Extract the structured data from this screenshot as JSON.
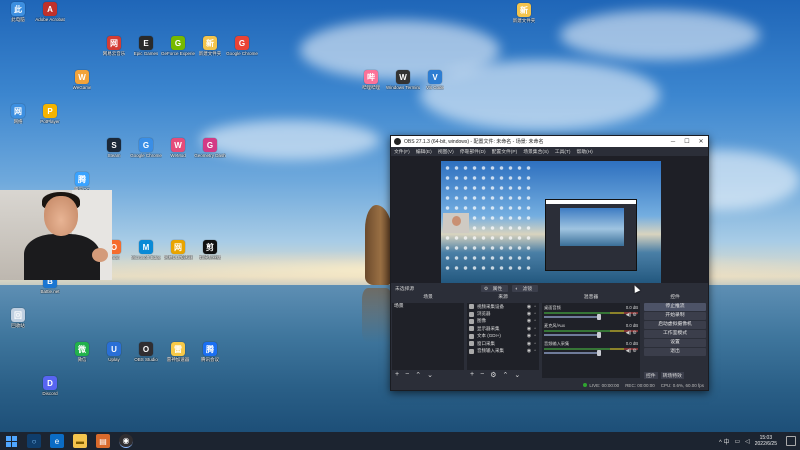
{
  "desktop": {
    "icons": [
      {
        "label": "此电脑",
        "icon": "computer-icon",
        "color": "#3d8fe0"
      },
      {
        "label": "网络",
        "icon": "network-icon",
        "color": "#3d8fe0"
      },
      {
        "label": "回收站",
        "icon": "recycle-bin-icon",
        "color": "#bfcfe0"
      },
      {
        "label": "Adobe Acrobat",
        "icon": "adobe-icon",
        "color": "#c0312b"
      },
      {
        "label": "PotPlayer",
        "icon": "potplayer-icon",
        "color": "#f5b400"
      },
      {
        "label": "Battle.net",
        "icon": "battlenet-icon",
        "color": "#1a76d2"
      },
      {
        "label": "Discord",
        "icon": "discord-icon",
        "color": "#5865f2"
      },
      {
        "label": "WeGame",
        "icon": "wegame-icon",
        "color": "#f2a33a"
      },
      {
        "label": "腾讯QQ",
        "icon": "qq-icon",
        "color": "#3aa3ff"
      },
      {
        "label": "微信",
        "icon": "wechat-icon",
        "color": "#22b14c"
      },
      {
        "label": "网易云音乐",
        "icon": "netease-music-icon",
        "color": "#d43c33"
      },
      {
        "label": "Steam",
        "icon": "steam-icon",
        "color": "#1b2838"
      },
      {
        "label": "Origin",
        "icon": "origin-icon",
        "color": "#f56c2d"
      },
      {
        "label": "Uplay",
        "icon": "uplay-icon",
        "color": "#2a6fd6"
      },
      {
        "label": "Epic Games",
        "icon": "epic-icon",
        "color": "#2a2a2a"
      },
      {
        "label": "Google Chrome",
        "icon": "chrome-icon",
        "color": "#3a8ee6"
      },
      {
        "label": "Microsoft Edge",
        "icon": "edge-icon",
        "color": "#0a8ad6"
      },
      {
        "label": "OBS Studio",
        "icon": "obs-icon",
        "color": "#302e31"
      },
      {
        "label": "GeForce Experience",
        "icon": "geforce-icon",
        "color": "#76b900"
      },
      {
        "label": "WeMod",
        "icon": "wemod-icon",
        "color": "#e54c7a"
      },
      {
        "label": "网易UU加速器",
        "icon": "uu-icon",
        "color": "#e9a400"
      },
      {
        "label": "雷神加速器",
        "icon": "leishen-icon",
        "color": "#f7c948"
      },
      {
        "label": "新建文件夹",
        "icon": "folder-icon",
        "color": "#f3c44d"
      },
      {
        "label": "Geometry Dash",
        "icon": "geometry-dash-icon",
        "color": "#d33a86"
      },
      {
        "label": "剪映专业版",
        "icon": "jianying-icon",
        "color": "#111111"
      },
      {
        "label": "腾讯会议",
        "icon": "tencent-meeting-icon",
        "color": "#1b6ff2"
      },
      {
        "label": "Google Chrome",
        "icon": "chrome-icon",
        "color": "#ea4335"
      },
      {
        "label": "哔哩哔哩",
        "icon": "bilibili-icon",
        "color": "#fb7299"
      },
      {
        "label": "Windows Terminal",
        "icon": "terminal-icon",
        "color": "#333333"
      },
      {
        "label": "VS Code",
        "icon": "vscode-icon",
        "color": "#2d7dd2"
      },
      {
        "label": "新建文件夹",
        "icon": "folder-icon",
        "color": "#f3c44d"
      }
    ]
  },
  "obs": {
    "title": "OBS 27.1.3 (64-bit, windows) - 配置文件: 未命名 - 场景: 未命名",
    "menu": [
      "文件(F)",
      "编辑(E)",
      "视图(V)",
      "停靠部件(D)",
      "配置文件(P)",
      "场景集合(S)",
      "工具(T)",
      "帮助(H)"
    ],
    "no_source_selected": "未选择源",
    "props_button": "属性",
    "filters_button": "滤镜",
    "docks": {
      "scenes": {
        "title": "场景",
        "items": [
          "场景"
        ]
      },
      "sources": {
        "title": "来源",
        "items": [
          "视频采集设备",
          "浏览器",
          "图像",
          "显示器采集",
          "文本 (GDI+)",
          "窗口采集",
          "音频输入采集"
        ]
      },
      "mixer": {
        "title": "混音器",
        "channels": [
          {
            "name": "桌面音频",
            "value": "0.0 dB"
          },
          {
            "name": "麦克风/Aux",
            "value": "0.0 dB"
          },
          {
            "name": "音频输入采集",
            "value": "0.0 dB"
          }
        ]
      },
      "controls": {
        "title": "控件",
        "buttons": [
          "停止推流",
          "开始录制",
          "启动虚拟摄像机",
          "工作室模式",
          "设置",
          "退出"
        ],
        "tabs": [
          "控件",
          "转场特效"
        ]
      }
    },
    "status": {
      "live": "LIVE: 00:00:00",
      "rec": "REC: 00:00:00",
      "cpu": "CPU: 0.6%, 60.00 fps"
    }
  },
  "taskbar": {
    "time": "15:03",
    "date": "2022/6/25",
    "tray": "^ 中"
  }
}
